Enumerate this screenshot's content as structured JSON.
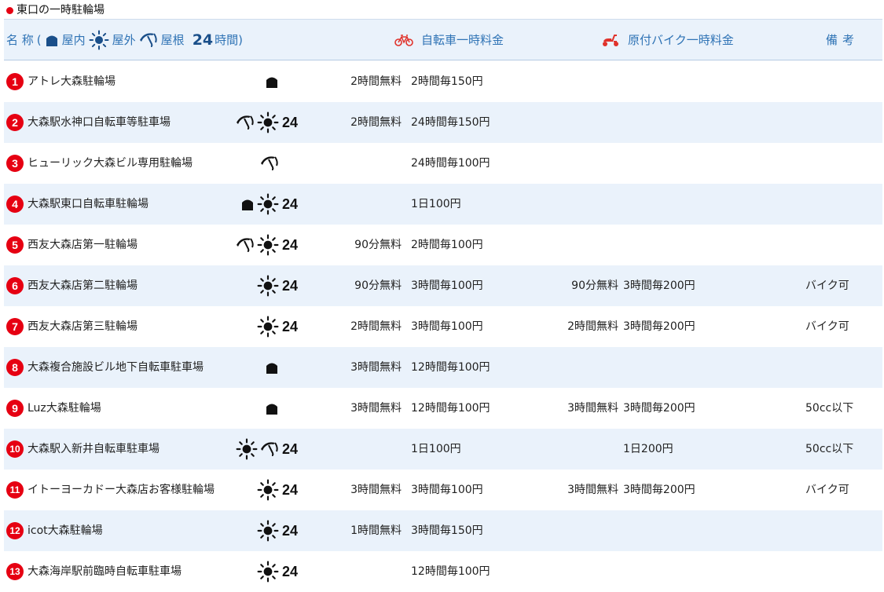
{
  "section": {
    "title": "東口の一時駐輪場",
    "dot_color": "#e60012"
  },
  "header": {
    "name_label": "名 称",
    "open_paren": "(",
    "indoor_label": "屋内",
    "outdoor_label": "屋外",
    "roof_label": "屋根",
    "hours_label": "24",
    "hours_suffix": "時間)",
    "bicycle_label": "自転車一時料金",
    "moped_label": "原付バイク一時料金",
    "notes_label": "備考"
  },
  "colors": {
    "header_bg": "#eaf2fb",
    "header_text": "#2f73b5",
    "alt_row_bg": "#eaf2fb",
    "badge": "#e60012"
  },
  "rows": [
    {
      "num": "1",
      "name": "アトレ大森駐輪場",
      "icons": [
        "indoor"
      ],
      "hours": "",
      "bike_free": "2時間無料",
      "bike_fee": "2時間毎150円",
      "moto_free": "",
      "moto_fee": "",
      "note": ""
    },
    {
      "num": "2",
      "name": "大森駅水神口自転車等駐車場",
      "icons": [
        "roof",
        "outdoor"
      ],
      "hours": "24",
      "bike_free": "2時間無料",
      "bike_fee": "24時間毎150円",
      "moto_free": "",
      "moto_fee": "",
      "note": ""
    },
    {
      "num": "3",
      "name": "ヒューリック大森ビル専用駐輪場",
      "icons": [
        "roof"
      ],
      "hours": "",
      "bike_free": "",
      "bike_fee": "24時間毎100円",
      "moto_free": "",
      "moto_fee": "",
      "note": ""
    },
    {
      "num": "4",
      "name": "大森駅東口自転車駐輪場",
      "icons": [
        "indoor",
        "outdoor"
      ],
      "hours": "24",
      "bike_free": "",
      "bike_fee": "1日100円",
      "moto_free": "",
      "moto_fee": "",
      "note": ""
    },
    {
      "num": "5",
      "name": "西友大森店第一駐輪場",
      "icons": [
        "roof",
        "outdoor"
      ],
      "hours": "24",
      "bike_free": "90分無料",
      "bike_fee": "2時間毎100円",
      "moto_free": "",
      "moto_fee": "",
      "note": ""
    },
    {
      "num": "6",
      "name": "西友大森店第二駐輪場",
      "icons": [
        "outdoor"
      ],
      "hours": "24",
      "bike_free": "90分無料",
      "bike_fee": "3時間毎100円",
      "moto_free": "90分無料",
      "moto_fee": "3時間毎200円",
      "note": "バイク可"
    },
    {
      "num": "7",
      "name": "西友大森店第三駐輪場",
      "icons": [
        "outdoor"
      ],
      "hours": "24",
      "bike_free": "2時間無料",
      "bike_fee": "3時間毎100円",
      "moto_free": "2時間無料",
      "moto_fee": "3時間毎200円",
      "note": "バイク可"
    },
    {
      "num": "8",
      "name": "大森複合施設ビル地下自転車駐車場",
      "icons": [
        "indoor"
      ],
      "hours": "",
      "bike_free": "3時間無料",
      "bike_fee": "12時間毎100円",
      "moto_free": "",
      "moto_fee": "",
      "note": ""
    },
    {
      "num": "9",
      "name": "Luz大森駐輪場",
      "icons": [
        "indoor"
      ],
      "hours": "",
      "bike_free": "3時間無料",
      "bike_fee": "12時間毎100円",
      "moto_free": "3時間無料",
      "moto_fee": "3時間毎200円",
      "note": "50cc以下"
    },
    {
      "num": "10",
      "name": "大森駅入新井自転車駐車場",
      "icons": [
        "outdoor",
        "roof"
      ],
      "hours": "24",
      "bike_free": "",
      "bike_fee": "1日100円",
      "moto_free": "",
      "moto_fee": "1日200円",
      "note": "50cc以下"
    },
    {
      "num": "11",
      "name": "イトーヨーカドー大森店お客様駐輪場",
      "icons": [
        "outdoor"
      ],
      "hours": "24",
      "bike_free": "3時間無料",
      "bike_fee": "3時間毎100円",
      "moto_free": "3時間無料",
      "moto_fee": "3時間毎200円",
      "note": "バイク可"
    },
    {
      "num": "12",
      "name": "icot大森駐輪場",
      "icons": [
        "outdoor"
      ],
      "hours": "24",
      "bike_free": "1時間無料",
      "bike_fee": "3時間毎150円",
      "moto_free": "",
      "moto_fee": "",
      "note": ""
    },
    {
      "num": "13",
      "name": "大森海岸駅前臨時自転車駐車場",
      "icons": [
        "outdoor"
      ],
      "hours": "24",
      "bike_free": "",
      "bike_fee": "12時間毎100円",
      "moto_free": "",
      "moto_fee": "",
      "note": ""
    }
  ]
}
